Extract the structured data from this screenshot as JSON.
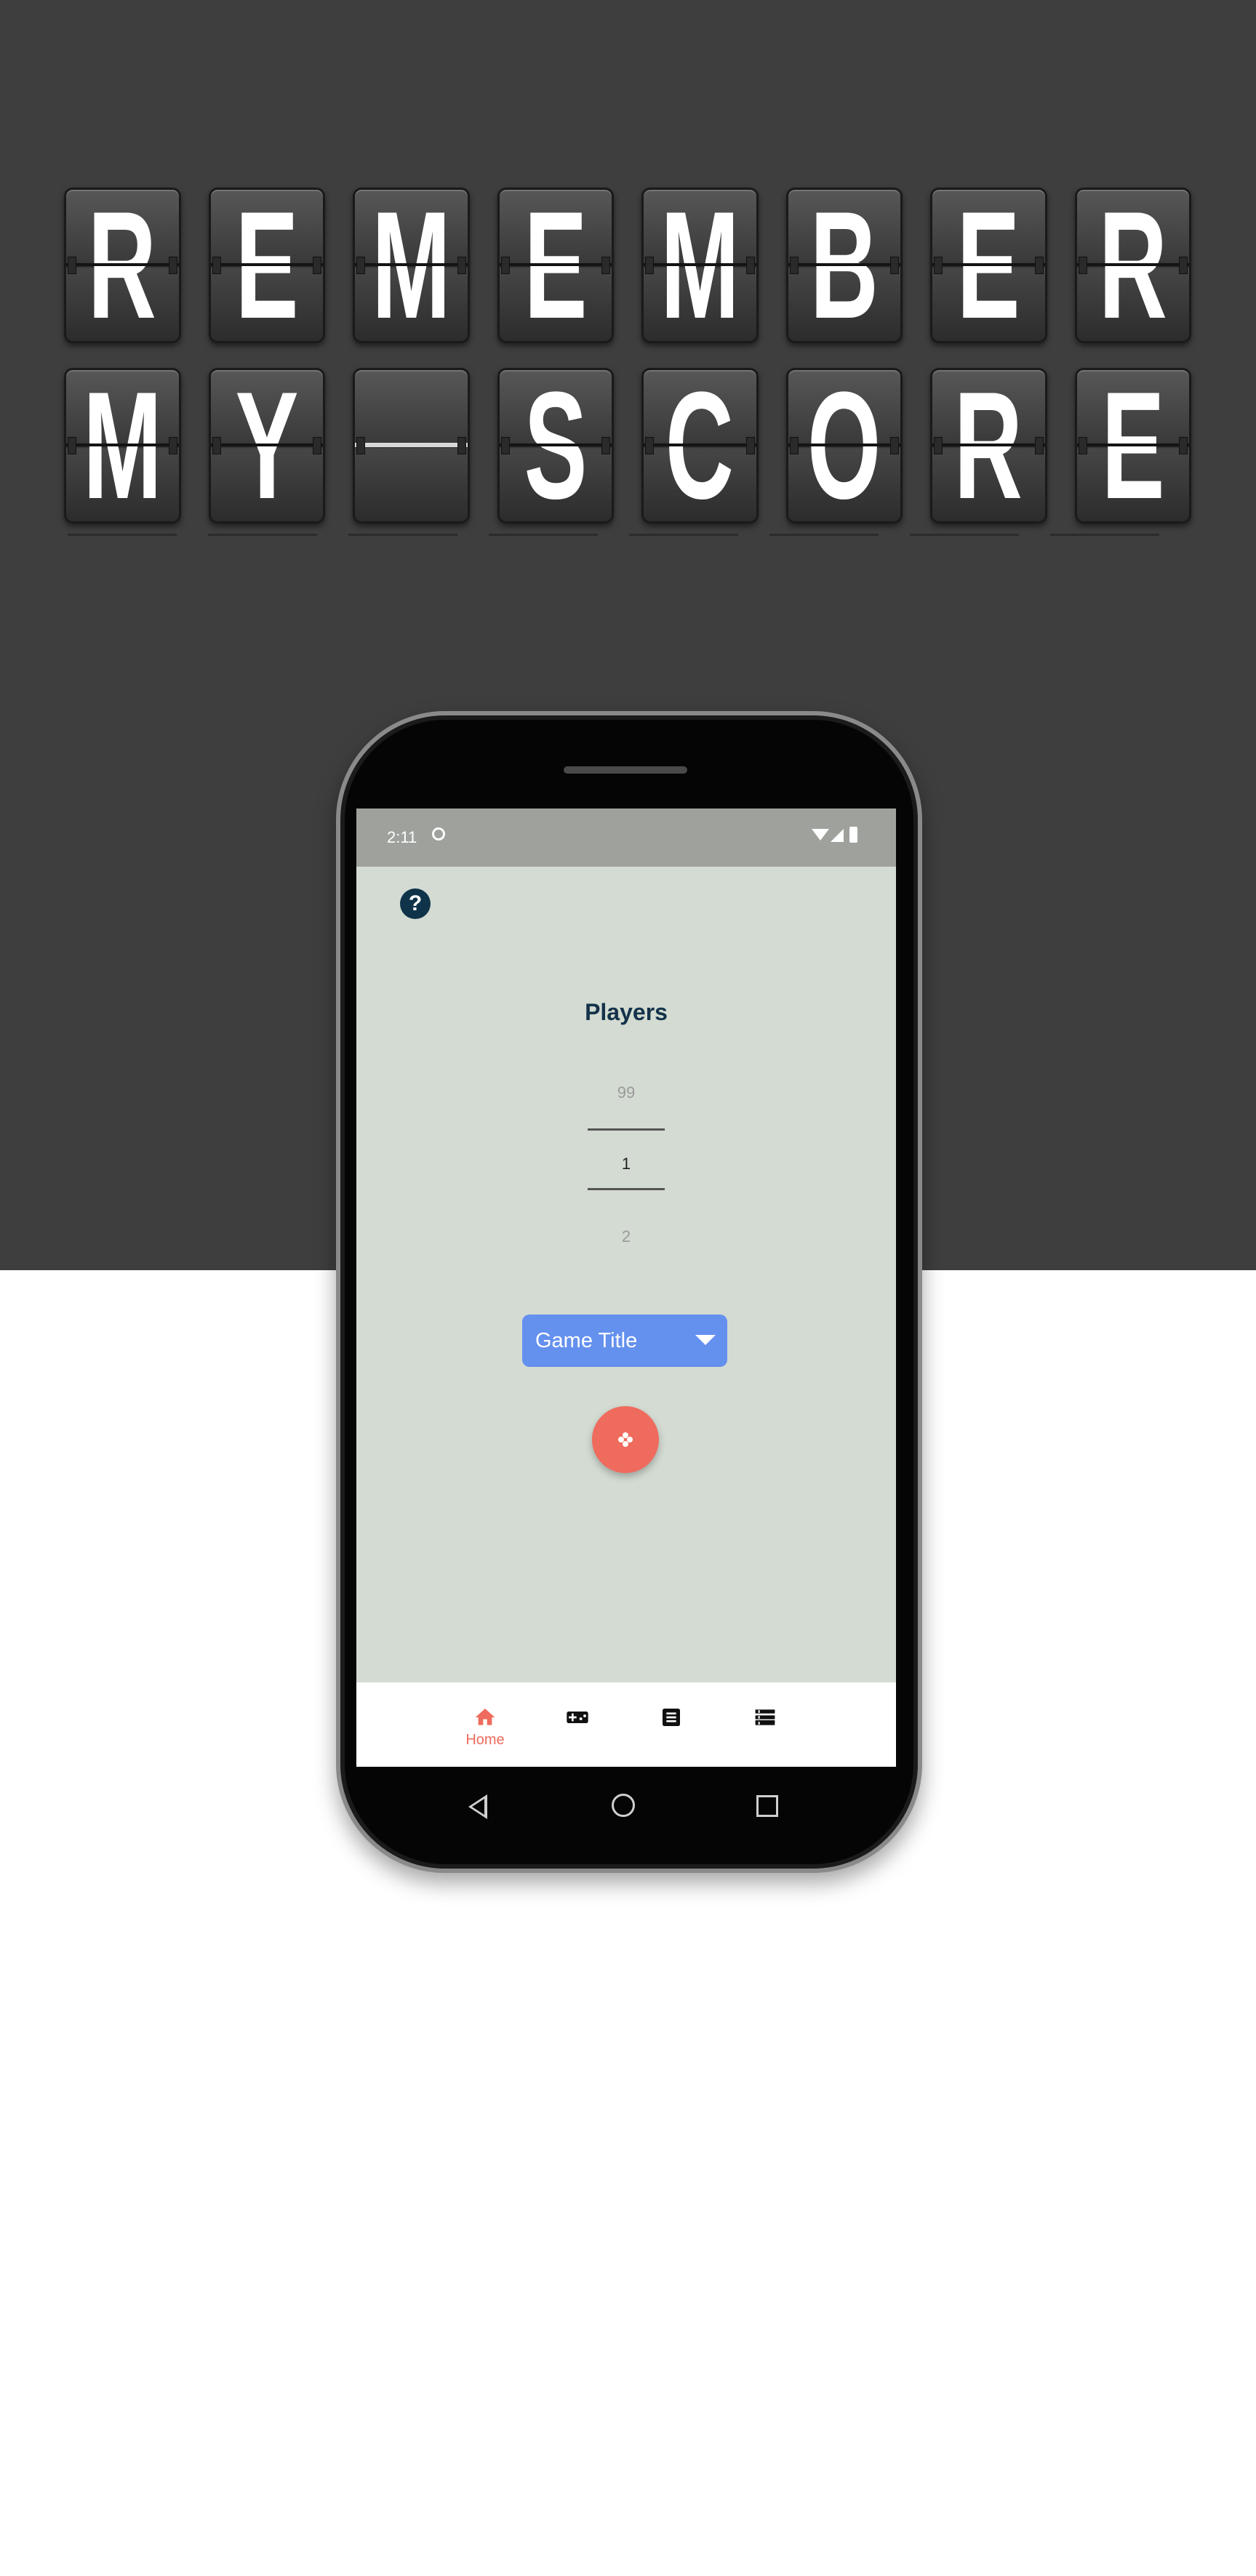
{
  "banner": {
    "row1": [
      "R",
      "E",
      "M",
      "E",
      "M",
      "B",
      "E",
      "R"
    ],
    "row2": [
      "M",
      "Y",
      "",
      "S",
      "C",
      "O",
      "R",
      "E"
    ]
  },
  "status_bar": {
    "time": "2:11",
    "icons": [
      "sync-icon",
      "wifi-icon",
      "signal-icon",
      "battery-icon"
    ]
  },
  "help": {
    "label": "?"
  },
  "players": {
    "title": "Players",
    "picker": {
      "previous": "99",
      "selected": "1",
      "next": "2"
    }
  },
  "game_select": {
    "value": "Game Title"
  },
  "fab": {
    "icon": "gamepad-icon"
  },
  "bottom_nav": {
    "items": [
      {
        "label": "Home",
        "icon": "home-icon",
        "active": true
      },
      {
        "label": "",
        "icon": "gamepad-icon",
        "active": false
      },
      {
        "label": "",
        "icon": "document-icon",
        "active": false
      },
      {
        "label": "",
        "icon": "list-icon",
        "active": false
      }
    ]
  },
  "android_nav": {
    "icons": [
      "back-icon",
      "home-circle-icon",
      "recents-icon"
    ]
  },
  "colors": {
    "banner_bg": "#3e3e3e",
    "screen_bg": "#d3dbd2",
    "status_bar": "#9ea19c",
    "accent": "#ee6b5d",
    "select_bg": "#6490ee",
    "title": "#14324a"
  }
}
